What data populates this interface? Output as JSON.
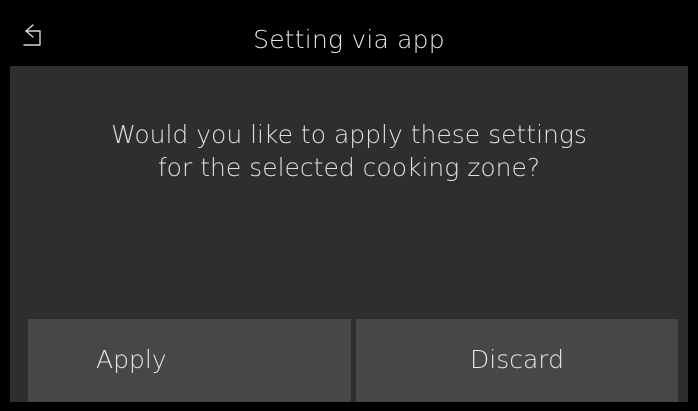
{
  "header": {
    "title": "Setting via app",
    "back_icon": "back-arrow-icon"
  },
  "dialog": {
    "message_line1": "Would you like to apply these settings",
    "message_line2": "for the selected cooking zone?"
  },
  "actions": {
    "apply_label": "Apply",
    "discard_label": "Discard"
  },
  "colors": {
    "background": "#000000",
    "panel": "#2e2e2e",
    "button": "#474747",
    "text": "#e6e6e6"
  }
}
